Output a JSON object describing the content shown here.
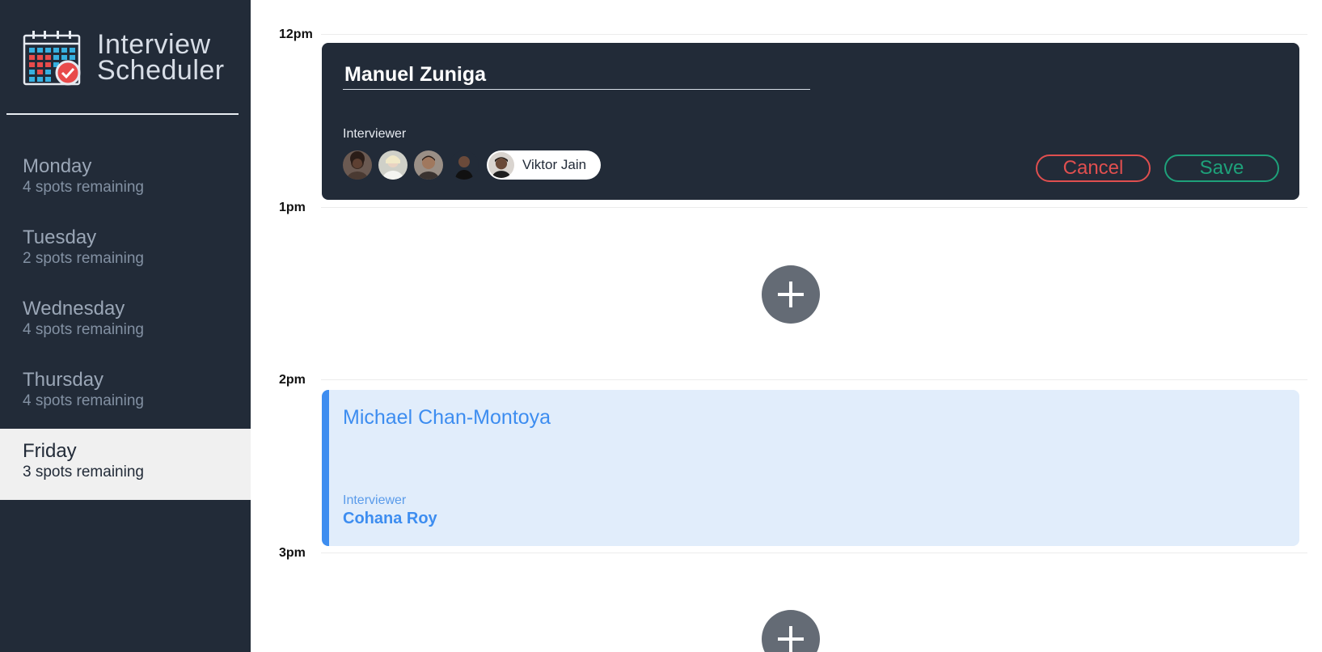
{
  "app": {
    "title_line1": "Interview",
    "title_line2": "Scheduler"
  },
  "days": [
    {
      "name": "Monday",
      "spots": "4 spots remaining",
      "selected": false
    },
    {
      "name": "Tuesday",
      "spots": "2 spots remaining",
      "selected": false
    },
    {
      "name": "Wednesday",
      "spots": "4 spots remaining",
      "selected": false
    },
    {
      "name": "Thursday",
      "spots": "4 spots remaining",
      "selected": false
    },
    {
      "name": "Friday",
      "spots": "3 spots remaining",
      "selected": true
    }
  ],
  "schedule": {
    "times": [
      "12pm",
      "1pm",
      "2pm",
      "3pm"
    ],
    "edit_form": {
      "student_name": "Manuel Zuniga",
      "interviewer_label": "Interviewer",
      "selected_interviewer": "Viktor Jain",
      "cancel_label": "Cancel",
      "save_label": "Save"
    },
    "booked": {
      "student": "Michael Chan-Montoya",
      "interviewer_label": "Interviewer",
      "interviewer": "Cohana Roy"
    }
  },
  "colors": {
    "sidebar_bg": "#222b38",
    "accent_blue": "#3d8df0",
    "cancel_red": "#e04f4f",
    "save_green": "#1ea17a",
    "add_button": "#646b75"
  },
  "icons": {
    "brand": "calendar-check-icon",
    "add": "plus-icon"
  }
}
